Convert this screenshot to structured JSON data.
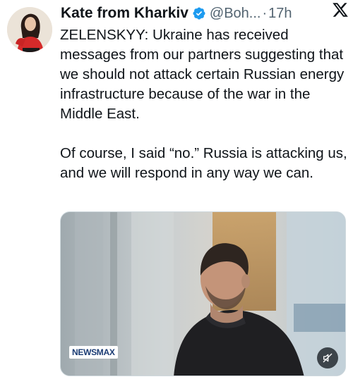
{
  "author": {
    "name": "Kate from Kharkiv",
    "handle": "@Boh...",
    "separator": "·",
    "time": "17h",
    "avatar_icon": "avatar-woman-red-top",
    "verified_icon": "verified-badge-icon",
    "verified_color": "#1d9bf0"
  },
  "tweet": {
    "paragraph_1": "ZELENSKYY: Ukraine has received messages from our partners suggesting that we should not attack certain Russian energy infrastructure because of the war in the Middle East.",
    "paragraph_2": "Of course, I said “no.” Russia is attacking us, and we will respond in any way we can."
  },
  "media": {
    "type": "video",
    "watermark": "NEWSMAX",
    "mute_icon": "muted-speaker-icon"
  },
  "platform": {
    "logo_icon": "x-logo-icon"
  },
  "colors": {
    "text": "#0f1419",
    "secondary": "#536471",
    "border": "#cfd9de"
  }
}
